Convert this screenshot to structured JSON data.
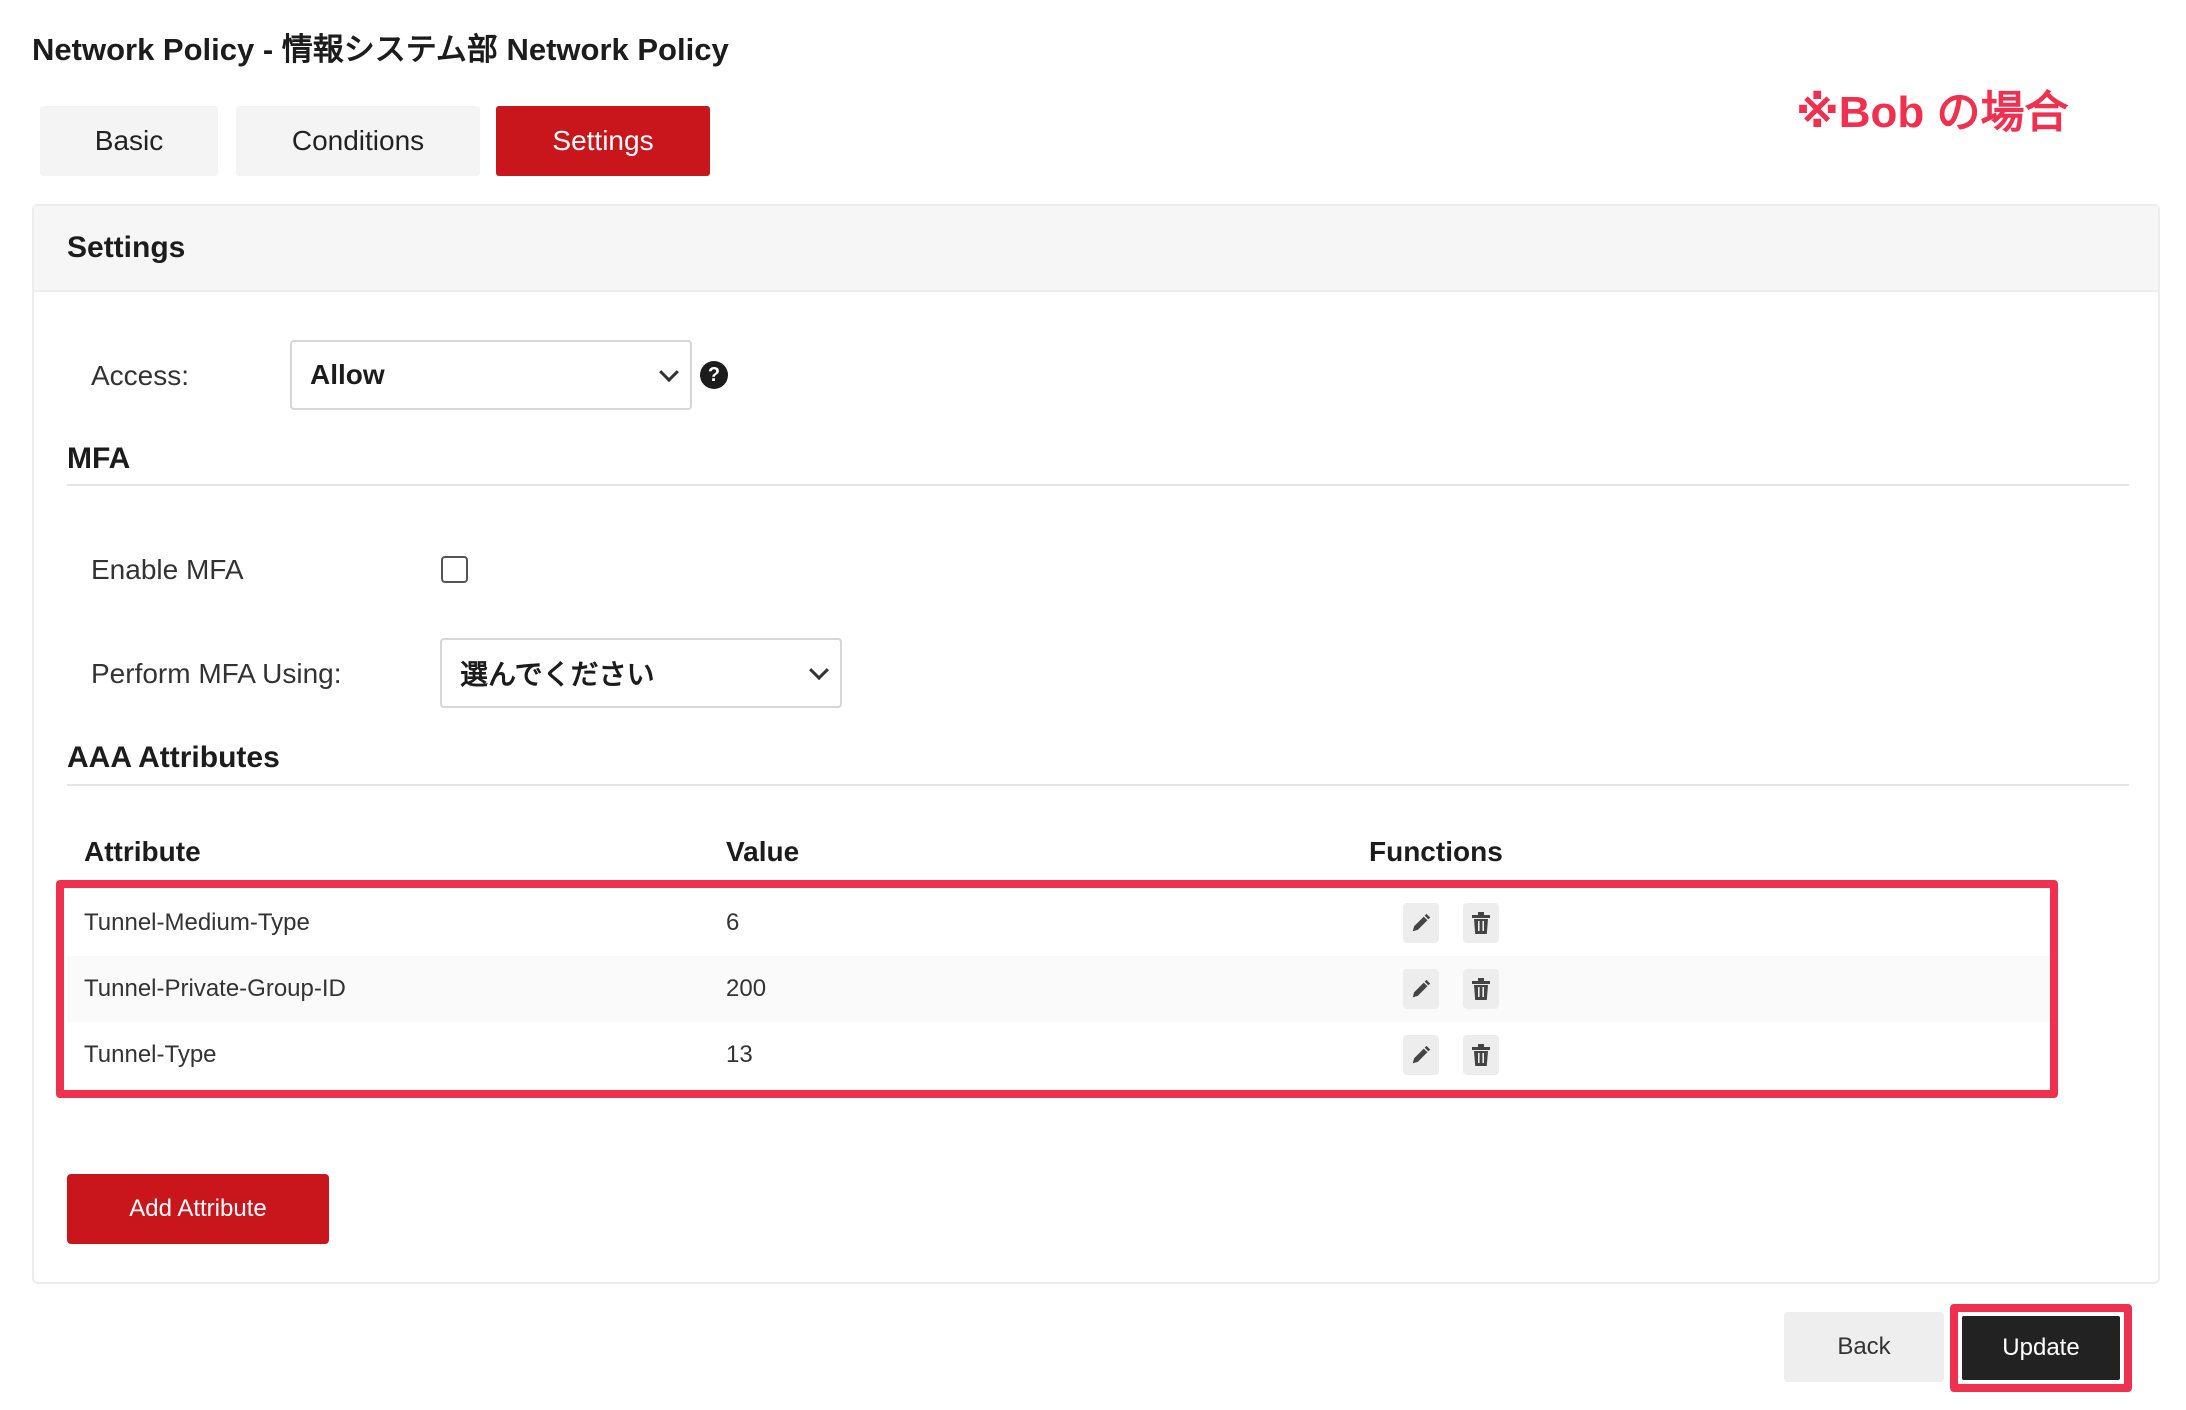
{
  "header": {
    "title": "Network Policy - 情報システム部 Network Policy",
    "annotation": "※Bob の場合"
  },
  "tabs": [
    {
      "label": "Basic",
      "active": false
    },
    {
      "label": "Conditions",
      "active": false
    },
    {
      "label": "Settings",
      "active": true
    }
  ],
  "settings": {
    "card_title": "Settings",
    "access_label": "Access:",
    "access_value": "Allow",
    "help_icon_glyph": "?"
  },
  "mfa": {
    "section_title": "MFA",
    "enable_label": "Enable MFA",
    "enable_checked": false,
    "perform_label": "Perform MFA Using:",
    "perform_value": "選んでください"
  },
  "aaa": {
    "section_title": "AAA Attributes",
    "columns": [
      "Attribute",
      "Value",
      "Functions"
    ],
    "rows": [
      {
        "attribute": "Tunnel-Medium-Type",
        "value": "6"
      },
      {
        "attribute": "Tunnel-Private-Group-ID",
        "value": "200"
      },
      {
        "attribute": "Tunnel-Type",
        "value": "13"
      }
    ],
    "row_icons": [
      "pencil-icon",
      "trash-icon"
    ],
    "add_label": "Add Attribute"
  },
  "footer": {
    "back_label": "Back",
    "update_label": "Update"
  },
  "colors": {
    "brand_red": "#c8161c",
    "annotation_red": "#f0304f",
    "dark_button": "#222222"
  }
}
